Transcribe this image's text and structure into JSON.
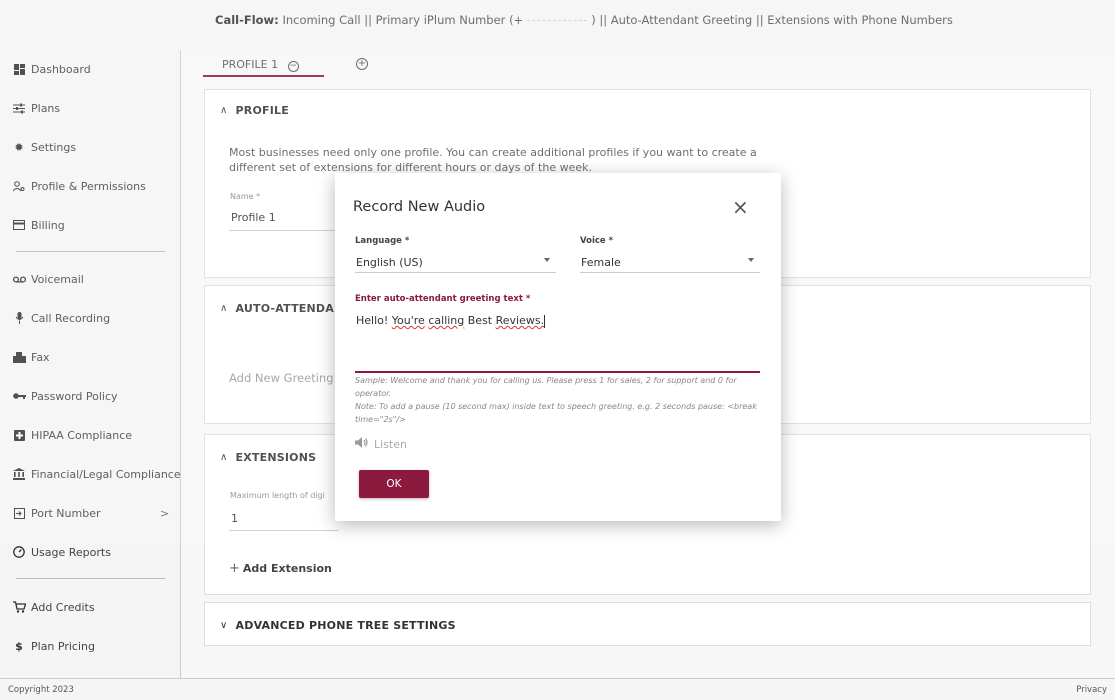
{
  "topbar": {
    "flow_label": "Call-Flow:",
    "flow_part1": "Incoming Call  ||  Primary iPlum Number (+",
    "flow_part2": ")  ||  Auto-Attendant Greeting  ||  Extensions with Phone Numbers"
  },
  "sidebar": {
    "items": [
      {
        "label": "Dashboard",
        "icon": "dashboard-icon"
      },
      {
        "label": "Plans",
        "icon": "sliders-icon"
      },
      {
        "label": "Settings",
        "icon": "gear-icon"
      },
      {
        "label": "Profile & Permissions",
        "icon": "user-permissions-icon"
      },
      {
        "label": "Billing",
        "icon": "credit-card-icon"
      },
      {
        "label": "Voicemail",
        "icon": "voicemail-icon"
      },
      {
        "label": "Call Recording",
        "icon": "microphone-icon"
      },
      {
        "label": "Fax",
        "icon": "fax-icon"
      },
      {
        "label": "Password Policy",
        "icon": "key-icon"
      },
      {
        "label": "HIPAA Compliance",
        "icon": "medical-plus-icon"
      },
      {
        "label": "Financial/Legal Compliance",
        "icon": "bank-icon"
      },
      {
        "label": "Port Number",
        "icon": "port-in-icon"
      },
      {
        "label": "Usage Reports",
        "icon": "gauge-icon"
      },
      {
        "label": "Add Credits",
        "icon": "cart-icon"
      },
      {
        "label": "Plan Pricing",
        "icon": "dollar-icon"
      }
    ],
    "port_chevron": ">"
  },
  "tabs": {
    "profile1": "PROFILE 1",
    "minus": "−",
    "add": "+"
  },
  "profile_card": {
    "title": "PROFILE",
    "description": "Most businesses need only one profile. You can create additional profiles if you want to create a different set of extensions for different hours or days of the week.",
    "name_label": "Name *",
    "name_value": "Profile 1"
  },
  "auto_card": {
    "title": "AUTO-ATTENDANT",
    "add_greeting": "Add New Greeting"
  },
  "ext_card": {
    "title": "EXTENSIONS",
    "max_label": "Maximum length of digi",
    "max_value": "1",
    "add_extension": "Add Extension"
  },
  "advanced_card": {
    "title": "ADVANCED PHONE TREE SETTINGS"
  },
  "footer": {
    "copyright": "Copyright 2023",
    "privacy": "Privacy"
  },
  "modal": {
    "title": "Record New Audio",
    "close": "×",
    "language_label": "Language *",
    "language_value": "English (US)",
    "voice_label": "Voice *",
    "voice_value": "Female",
    "greeting_label": "Enter auto-attendant greeting text *",
    "greeting_w1": "Hello!",
    "greeting_w2": "You're",
    "greeting_w3": "calling",
    "greeting_w4": "Best",
    "greeting_w5": "Reviews.",
    "hint": "Sample: Welcome and thank you for calling us. Please press 1 for sales, 2 for support and 0 for operator.",
    "note": "Note: To add a pause (10 second max) inside text to speech greeting. e.g. 2 seconds pause: <break time=\"2s\"/>",
    "listen": "Listen",
    "ok": "OK"
  },
  "colors": {
    "accent": "#8b1a3e",
    "sidebar_bg": "#f5f5f5",
    "card_border": "#dddddd"
  }
}
